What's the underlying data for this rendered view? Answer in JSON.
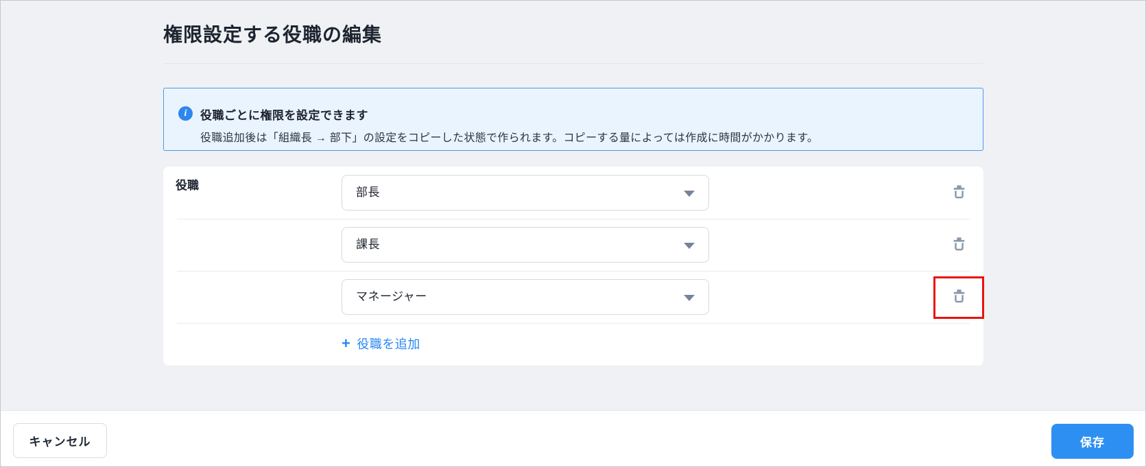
{
  "page": {
    "title": "権限設定する役職の編集"
  },
  "info_box": {
    "icon_glyph": "i",
    "title": "役職ごとに権限を設定できます",
    "description": "役職追加後は「組織長 → 部下」の設定をコピーした状態で作られます。コピーする量によっては作成に時間がかかります。"
  },
  "form": {
    "label": "役職",
    "roles": [
      {
        "value": "部長",
        "delete_highlighted": false
      },
      {
        "value": "課長",
        "delete_highlighted": false
      },
      {
        "value": "マネージャー",
        "delete_highlighted": true
      }
    ],
    "add_role": {
      "icon_glyph": "+",
      "label": "役職を追加"
    }
  },
  "footer": {
    "cancel_label": "キャンセル",
    "save_label": "保存"
  },
  "colors": {
    "page_bg": "#eff1f4",
    "accent_blue": "#2e8ff2",
    "link_blue": "#2787f5",
    "info_bg": "#eaf4fe",
    "info_border": "#4f97e3",
    "icon_gray": "#8a99ac",
    "highlight_red": "#e8130c"
  }
}
